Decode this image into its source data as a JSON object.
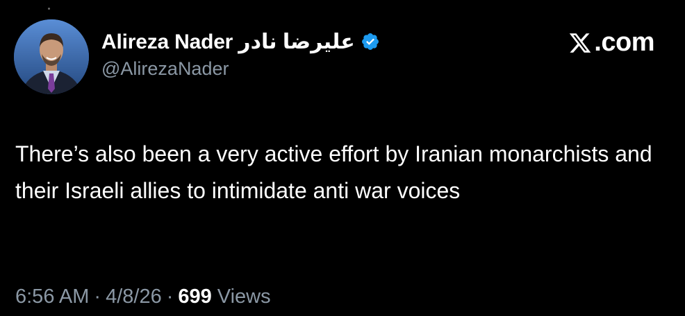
{
  "profile": {
    "display_name": "Alireza Nader علیرضا نادر",
    "handle": "@AlirezaNader",
    "verified": true
  },
  "brand": {
    "label": ".com",
    "logo_icon": "x-logo-icon"
  },
  "tweet": {
    "text": "There’s also been a very active effort by Iranian monarchists and their Israeli allies to intimidate anti war voices"
  },
  "meta": {
    "time": "6:56 AM",
    "separator": "·",
    "date": "4/8/26",
    "views_count": "699",
    "views_label": "Views"
  },
  "colors": {
    "background": "#000000",
    "text_primary": "#ffffff",
    "text_secondary": "#8b98a5",
    "verified_badge": "#1d9bf0"
  }
}
